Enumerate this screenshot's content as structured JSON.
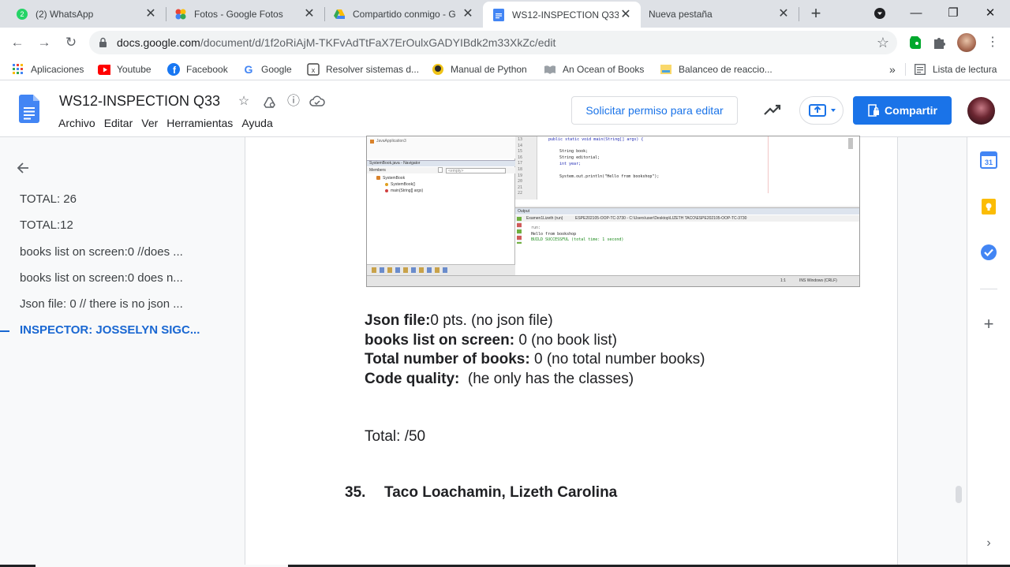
{
  "browser": {
    "tabs": [
      {
        "title": "(2) WhatsApp",
        "badge": "2",
        "active": false
      },
      {
        "title": "Fotos - Google Fotos",
        "active": false
      },
      {
        "title": "Compartido conmigo - G",
        "active": false
      },
      {
        "title": "WS12-INSPECTION Q33",
        "active": true
      },
      {
        "title": "Nueva pestaña",
        "active": false
      }
    ],
    "url_host": "docs.google.com",
    "url_path": "/document/d/1f2oRiAjM-TKFvAdTtFaX7ErOulxGADYIBdk2m33XkZc/edit",
    "bookmarks": [
      {
        "label": "Aplicaciones",
        "icon": "apps-grid-icon"
      },
      {
        "label": "Youtube",
        "icon": "youtube-icon"
      },
      {
        "label": "Facebook",
        "icon": "facebook-icon"
      },
      {
        "label": "Google",
        "icon": "google-icon"
      },
      {
        "label": "Resolver sistemas d...",
        "icon": "calculator-icon"
      },
      {
        "label": "Manual de Python",
        "icon": "python-icon"
      },
      {
        "label": "An Ocean of Books",
        "icon": "book-icon"
      },
      {
        "label": "Balanceo de reaccio...",
        "icon": "chemistry-icon"
      }
    ],
    "bookmarks_more": "»",
    "reading_list": "Lista de lectura"
  },
  "docs": {
    "title": "WS12-INSPECTION Q33",
    "menu": [
      "Archivo",
      "Editar",
      "Ver",
      "Herramientas",
      "Ayuda"
    ],
    "request_edit": "Solicitar permiso para editar",
    "share": "Compartir",
    "accent": "#1a73e8"
  },
  "outline": {
    "items": [
      {
        "label": "TOTAL: 26",
        "active": false
      },
      {
        "label": "TOTAL:12",
        "active": false
      },
      {
        "label": "books list on screen:0 //does ...",
        "active": false
      },
      {
        "label": "books list on screen:0 does n...",
        "active": false
      },
      {
        "label": "Json file: 0 // there is no json ...",
        "active": false
      },
      {
        "label": "INSPECTOR: JOSSELYN SIGC...",
        "active": true
      }
    ]
  },
  "document": {
    "lines": [
      {
        "label": "Json file:",
        "value": "0 pts. (no json file)"
      },
      {
        "label": "books list on screen:",
        "value": " 0 (no book list)"
      },
      {
        "label": "Total number of books:",
        "value": " 0 (no total number books)"
      },
      {
        "label": "Code quality:",
        "value": "  (he only has the classes)"
      }
    ],
    "total": "Total: /50",
    "heading_number": "35.",
    "heading_text": "Taco Loachamin, Lizeth Carolina"
  },
  "ide": {
    "navigator_title": "SystemBook.java - Navigator",
    "members": "Members",
    "empty": "<empty>",
    "tree": [
      "SystemBook",
      "SystemBook()",
      "main(String[] args)"
    ],
    "projects": [
      "JavaApplication3"
    ],
    "line_numbers": [
      "13",
      "14",
      "15",
      "16",
      "17",
      "18",
      "19",
      "20",
      "21",
      "22"
    ],
    "code": [
      "public static void main(String[] args) {",
      "String book;",
      "String editorial;",
      "int year;",
      "System.out.println(\"Hello from bookshop\");"
    ],
    "output_tab": "Output",
    "output_subtab": "Examen1Lizeth (run)",
    "output_path": "ESPE202105-OOP-TC-3730 - C:\\Users\\user\\Desktop\\LIZETH TACO\\ESPE202105-OOP-TC-3730",
    "output_lines": [
      "run:",
      "Hello from bookshop",
      "BUILD SUCCESSFUL (total time: 1 second)"
    ],
    "status_pos": "1:1",
    "status_ins": "INS Windows (CRLF)"
  }
}
